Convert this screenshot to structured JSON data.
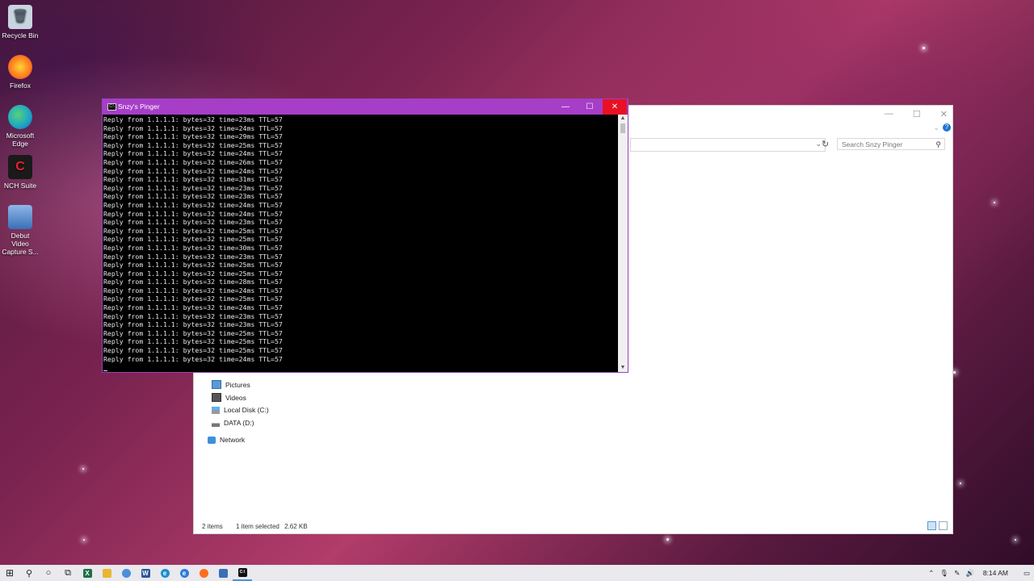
{
  "desktop": {
    "icons": [
      {
        "label": "Recycle Bin",
        "icon": "recycle-bin-icon",
        "color": "#c8d4e0"
      },
      {
        "label": "Firefox",
        "icon": "firefox-icon",
        "color": "#ff7a1a"
      },
      {
        "label": "Microsoft Edge",
        "icon": "edge-icon",
        "color": "#1ca37a"
      },
      {
        "label": "NCH Suite",
        "icon": "nch-suite-icon",
        "color": "#c0161d"
      },
      {
        "label": "Debut Video Capture S...",
        "icon": "debut-video-icon",
        "color": "#3a6fb6"
      }
    ]
  },
  "explorer": {
    "search_placeholder": "Search Snzy Pinger",
    "nav": [
      {
        "label": "Pictures",
        "icon": "pictures-icon"
      },
      {
        "label": "Videos",
        "icon": "videos-icon"
      },
      {
        "label": "Local Disk (C:)",
        "icon": "local-disk-icon"
      },
      {
        "label": "DATA (D:)",
        "icon": "drive-icon"
      },
      {
        "label": "Network",
        "icon": "network-icon"
      }
    ],
    "status": {
      "items": "2 items",
      "selected": "1 item selected",
      "size": "2.62 KB"
    }
  },
  "console": {
    "title": "Snzy's Pinger",
    "accent": "#a63ec8",
    "lines": [
      "Reply from 1.1.1.1: bytes=32 time=23ms TTL=57",
      "Reply from 1.1.1.1: bytes=32 time=24ms TTL=57",
      "Reply from 1.1.1.1: bytes=32 time=29ms TTL=57",
      "Reply from 1.1.1.1: bytes=32 time=25ms TTL=57",
      "Reply from 1.1.1.1: bytes=32 time=24ms TTL=57",
      "Reply from 1.1.1.1: bytes=32 time=26ms TTL=57",
      "Reply from 1.1.1.1: bytes=32 time=24ms TTL=57",
      "Reply from 1.1.1.1: bytes=32 time=31ms TTL=57",
      "Reply from 1.1.1.1: bytes=32 time=23ms TTL=57",
      "Reply from 1.1.1.1: bytes=32 time=23ms TTL=57",
      "Reply from 1.1.1.1: bytes=32 time=24ms TTL=57",
      "Reply from 1.1.1.1: bytes=32 time=24ms TTL=57",
      "Reply from 1.1.1.1: bytes=32 time=23ms TTL=57",
      "Reply from 1.1.1.1: bytes=32 time=25ms TTL=57",
      "Reply from 1.1.1.1: bytes=32 time=25ms TTL=57",
      "Reply from 1.1.1.1: bytes=32 time=30ms TTL=57",
      "Reply from 1.1.1.1: bytes=32 time=23ms TTL=57",
      "Reply from 1.1.1.1: bytes=32 time=25ms TTL=57",
      "Reply from 1.1.1.1: bytes=32 time=25ms TTL=57",
      "Reply from 1.1.1.1: bytes=32 time=28ms TTL=57",
      "Reply from 1.1.1.1: bytes=32 time=24ms TTL=57",
      "Reply from 1.1.1.1: bytes=32 time=25ms TTL=57",
      "Reply from 1.1.1.1: bytes=32 time=24ms TTL=57",
      "Reply from 1.1.1.1: bytes=32 time=23ms TTL=57",
      "Reply from 1.1.1.1: bytes=32 time=23ms TTL=57",
      "Reply from 1.1.1.1: bytes=32 time=25ms TTL=57",
      "Reply from 1.1.1.1: bytes=32 time=25ms TTL=57",
      "Reply from 1.1.1.1: bytes=32 time=25ms TTL=57",
      "Reply from 1.1.1.1: bytes=32 time=24ms TTL=57"
    ]
  },
  "taskbar": {
    "apps": [
      {
        "name": "start-button",
        "glyph": "⊞",
        "color": "#222"
      },
      {
        "name": "search-icon",
        "glyph": "⚲",
        "color": "#222"
      },
      {
        "name": "cortana-icon",
        "glyph": "○",
        "color": "#222"
      },
      {
        "name": "task-view-icon",
        "glyph": "⧉",
        "color": "#222"
      },
      {
        "name": "excel-icon",
        "glyph": "X",
        "color": "#1d7044"
      },
      {
        "name": "file-explorer-icon",
        "glyph": "▬",
        "color": "#e8b730"
      },
      {
        "name": "chrome-like-icon",
        "glyph": "◎",
        "color": "#4a8fd8"
      },
      {
        "name": "word-icon",
        "glyph": "W",
        "color": "#2b5797"
      },
      {
        "name": "edge-icon",
        "glyph": "e",
        "color": "#1a8fd0"
      },
      {
        "name": "edge-beta-icon",
        "glyph": "e",
        "color": "#2f7be0"
      },
      {
        "name": "firefox-icon",
        "glyph": "●",
        "color": "#ff6d1f"
      },
      {
        "name": "debut-video-icon",
        "glyph": "▮",
        "color": "#3a6fb6"
      },
      {
        "name": "console-icon",
        "glyph": "C:\\",
        "color": "#111"
      }
    ],
    "clock": "8:14 AM"
  }
}
